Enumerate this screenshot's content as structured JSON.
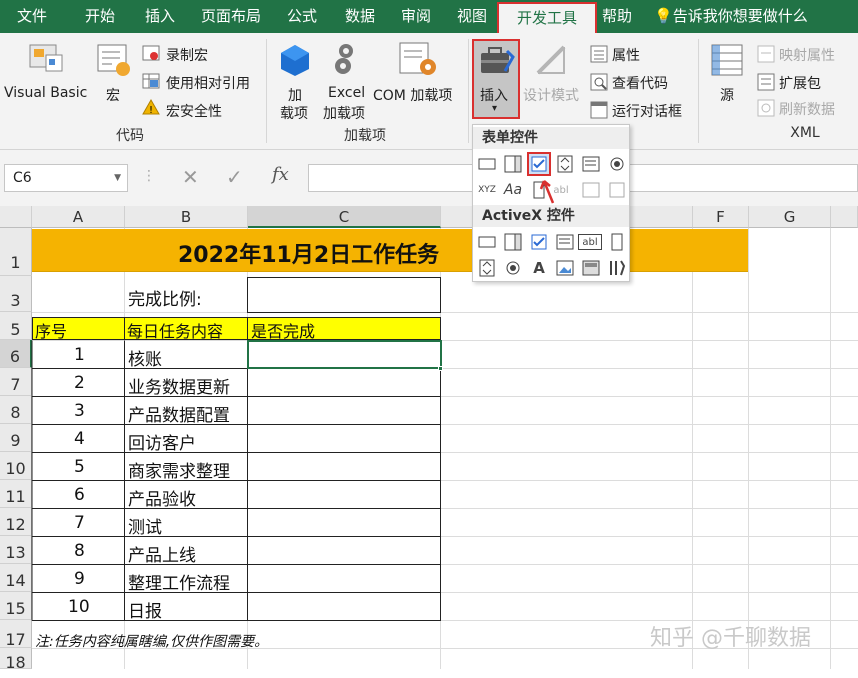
{
  "tabs": [
    "文件",
    "开始",
    "插入",
    "页面布局",
    "公式",
    "数据",
    "审阅",
    "视图",
    "开发工具",
    "帮助"
  ],
  "tellme": "告诉我你想要做什么",
  "ribbon": {
    "code_group": "代码",
    "visual_basic": "Visual Basic",
    "macros": "宏",
    "record_macro": "录制宏",
    "relative_ref": "使用相对引用",
    "macro_security": "宏安全性",
    "addins_group": "加载项",
    "addins_l1": "加",
    "addins_l2": "载项",
    "excel_addins_l1": "Excel",
    "excel_addins_l2": "加载项",
    "com_addins": "COM 加载项",
    "insert": "插入",
    "design_mode": "设计模式",
    "properties": "属性",
    "view_code": "查看代码",
    "run_dialog": "运行对话框",
    "source": "源",
    "map_props": "映射属性",
    "expansion_packs": "扩展包",
    "refresh_data": "刷新数据",
    "xml_group": "XML"
  },
  "dropdown": {
    "form_controls": "表单控件",
    "activex": "ActiveX 控件"
  },
  "namebox": "C6",
  "columns": [
    "A",
    "B",
    "C",
    "F",
    "G"
  ],
  "rows": [
    "1",
    "3",
    "5",
    "6",
    "7",
    "8",
    "9",
    "10",
    "11",
    "12",
    "13",
    "14",
    "15",
    "17",
    "18"
  ],
  "sheet": {
    "title": "2022年11月2日工作任务",
    "ratio_label": "完成比例:",
    "headers": [
      "序号",
      "每日任务内容",
      "是否完成"
    ],
    "tasks": [
      {
        "n": "1",
        "t": "核账"
      },
      {
        "n": "2",
        "t": "业务数据更新"
      },
      {
        "n": "3",
        "t": "产品数据配置"
      },
      {
        "n": "4",
        "t": "回访客户"
      },
      {
        "n": "5",
        "t": "商家需求整理"
      },
      {
        "n": "6",
        "t": "产品验收"
      },
      {
        "n": "7",
        "t": "测试"
      },
      {
        "n": "8",
        "t": "产品上线"
      },
      {
        "n": "9",
        "t": "整理工作流程"
      },
      {
        "n": "10",
        "t": "日报"
      }
    ],
    "note": "注:任务内容纯属瞎编,仅供作图需要。"
  },
  "watermark": "知乎 @千聊数据",
  "colors": {
    "accent": "#217346",
    "title_bg": "#f5b301",
    "header_bg": "#ffff00",
    "highlight": "#d9302f"
  }
}
